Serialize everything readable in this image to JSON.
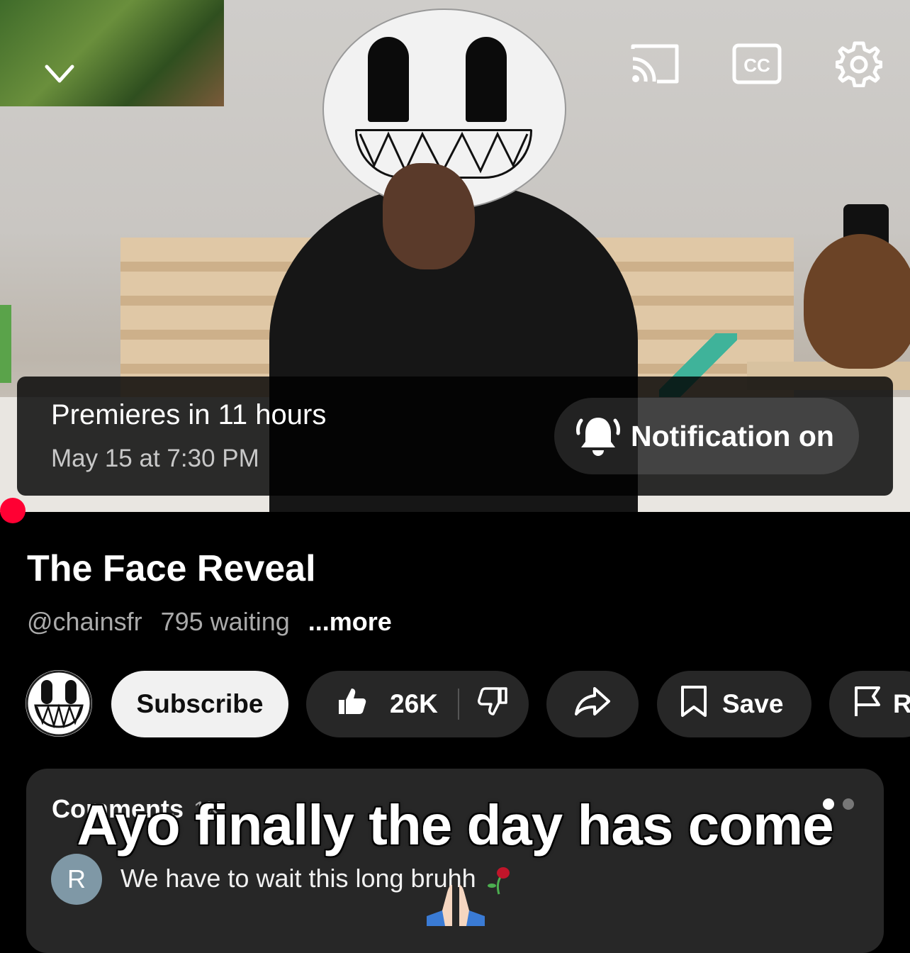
{
  "player": {
    "premiere_title": "Premieres in 11 hours",
    "premiere_date": "May 15 at 7:30 PM",
    "notification_label": "Notification on"
  },
  "video": {
    "title": "The Face Reveal",
    "channel_handle": "@chainsfr",
    "waiting": "795 waiting",
    "more_label": "...more"
  },
  "actions": {
    "subscribe_label": "Subscribe",
    "like_count": "26K",
    "save_label": "Save",
    "report_label": "R"
  },
  "comments": {
    "header": "Comments",
    "count": "1K",
    "top_comment_avatar": "R",
    "top_comment_text": "We have to wait this long bruhh"
  },
  "overlay": {
    "caption": "Ayo finally the day has come"
  },
  "colors": {
    "accent_red": "#ff0033",
    "pill_bg": "#272727",
    "subscribe_bg": "#f1f1f1"
  }
}
